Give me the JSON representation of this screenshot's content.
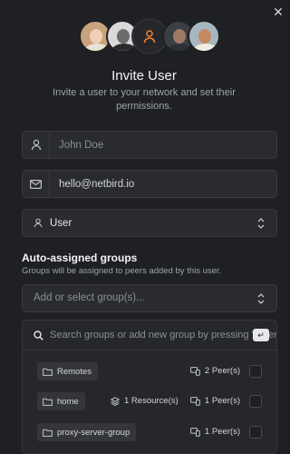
{
  "modal": {
    "title": "Invite User",
    "subtitle": "Invite a user to your network and set their permissions."
  },
  "avatars": [
    "avatar-woman-blonde",
    "avatar-man-beard",
    "user-icon",
    "avatar-man-dark",
    "avatar-man-cap"
  ],
  "form": {
    "name_placeholder": "John Doe",
    "email_value": "hello@netbird.io",
    "role_value": "User"
  },
  "groups": {
    "title": "Auto-assigned groups",
    "subtitle": "Groups will be assigned to peers added by this user.",
    "select_placeholder": "Add or select group(s)...",
    "search_placeholder": "Search groups or add new group by pressing 'Enter'...",
    "enter_key": "↵",
    "items": [
      {
        "name": "Remotes",
        "resources": "",
        "peers": "2 Peer(s)"
      },
      {
        "name": "home",
        "resources": "1 Resource(s)",
        "peers": "1 Peer(s)"
      },
      {
        "name": "proxy-server-group",
        "resources": "",
        "peers": "1 Peer(s)"
      }
    ]
  },
  "colors": {
    "background": "#1f2023",
    "field": "#2a2b2f",
    "accent": "#f68330"
  }
}
